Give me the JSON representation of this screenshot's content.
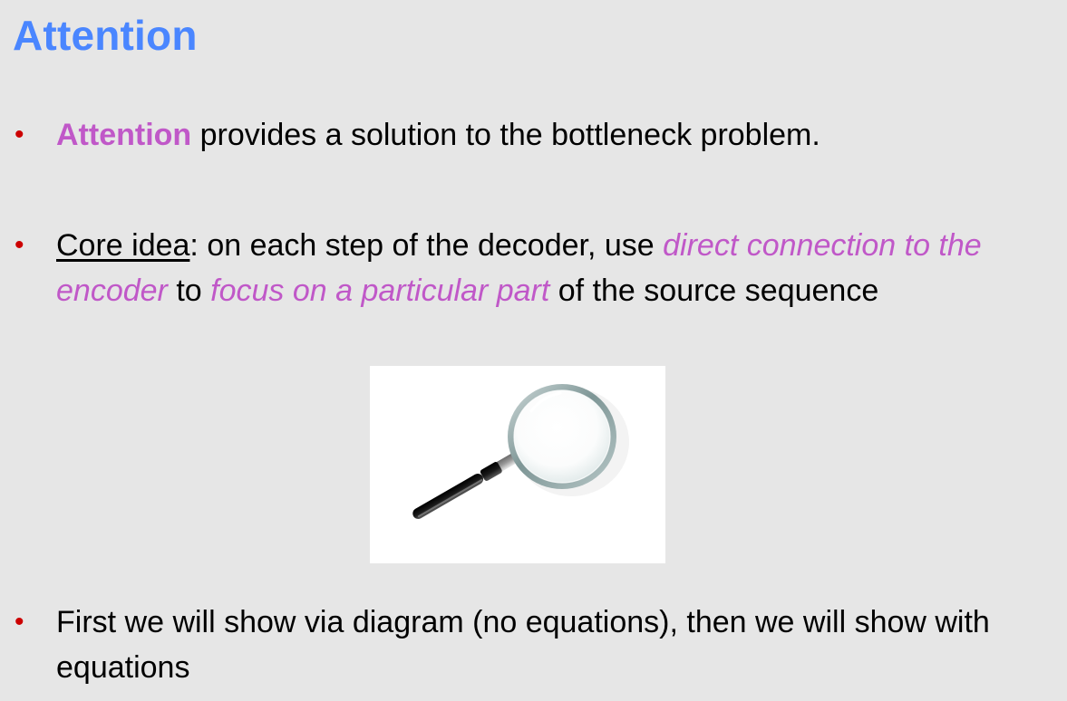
{
  "slide": {
    "title": "Attention",
    "bullets": [
      {
        "highlight": "Attention",
        "rest": " provides a solution to the bottleneck problem."
      },
      {
        "label": "Core idea",
        "part1": ": on each step of the decoder, use ",
        "em1": "direct connection to the encoder",
        "part2": " to ",
        "em2": "focus on a particular part",
        "part3": " of the source sequence"
      },
      {
        "text": "First we will show via diagram (no equations), then we will show with equations"
      }
    ],
    "image_icon": "magnifying-glass-icon"
  },
  "colors": {
    "title": "#4a86ff",
    "highlight": "#c058c8",
    "bullet_marker": "#cc0000",
    "background": "#e6e6e6"
  }
}
